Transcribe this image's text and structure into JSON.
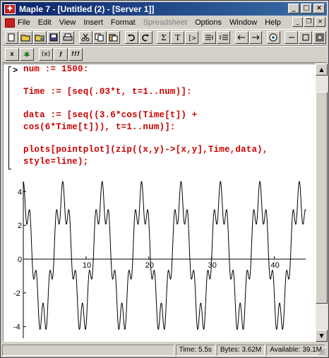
{
  "window": {
    "title": "Maple 7 - [Untitled (2) - [Server 1]]",
    "controls": {
      "minimize": "_",
      "maximize": "□",
      "close": "×"
    }
  },
  "menu": {
    "items": [
      "File",
      "Edit",
      "View",
      "Insert",
      "Format",
      "Spreadsheet",
      "Options",
      "Window",
      "Help"
    ],
    "disabled": [
      "Spreadsheet"
    ]
  },
  "toolbar1": {
    "tools": [
      "new-icon",
      "open-icon",
      "open-url-icon",
      "save-icon",
      "print-icon",
      "cut-icon",
      "copy-icon",
      "paste-icon",
      "undo-icon",
      "redo-icon",
      "sigma-icon",
      "text-icon",
      "prompt-icon",
      "split-icon",
      "back-icon",
      "forward-icon",
      "stop-icon",
      "zoom-100-icon",
      "zoom-200-icon",
      "zoom-400-icon"
    ]
  },
  "toolbar2": {
    "labels": [
      "x",
      "",
      "(x)",
      "!",
      "!!!"
    ]
  },
  "worksheet": {
    "prompt": ">",
    "code_lines": [
      "num := 1500:",
      "",
      "Time := [seq(.03*t, t=1..num)]:",
      "",
      "data := [seq((3.6*cos(Time[t]) +",
      "cos(6*Time[t])), t=1..num)]:",
      "",
      "plots[pointplot](zip((x,y)->[x,y],Time,data),",
      "style=line);"
    ],
    "code_color": "#cc0000"
  },
  "chart_data": {
    "type": "line",
    "title": "",
    "xlabel": "",
    "ylabel": "",
    "xlim": [
      0,
      45
    ],
    "ylim": [
      -4.6,
      4.6
    ],
    "x_ticks": [
      10,
      20,
      30,
      40
    ],
    "y_ticks": [
      4,
      2,
      0,
      -2,
      -4
    ],
    "x_tick_labels": [
      "10",
      "20",
      "30",
      "40"
    ],
    "y_tick_labels": [
      "4",
      "2",
      "0",
      "-2",
      "-4"
    ],
    "series": [
      {
        "formula": "3.6*cos(t) + cos(6*t)",
        "t_start": 0.03,
        "t_step": 0.03,
        "count": 1500,
        "color": "#000000"
      }
    ]
  },
  "status": {
    "time": "Time: 5.5s",
    "bytes": "Bytes: 3.62M",
    "available": "Available: 39.1M"
  }
}
